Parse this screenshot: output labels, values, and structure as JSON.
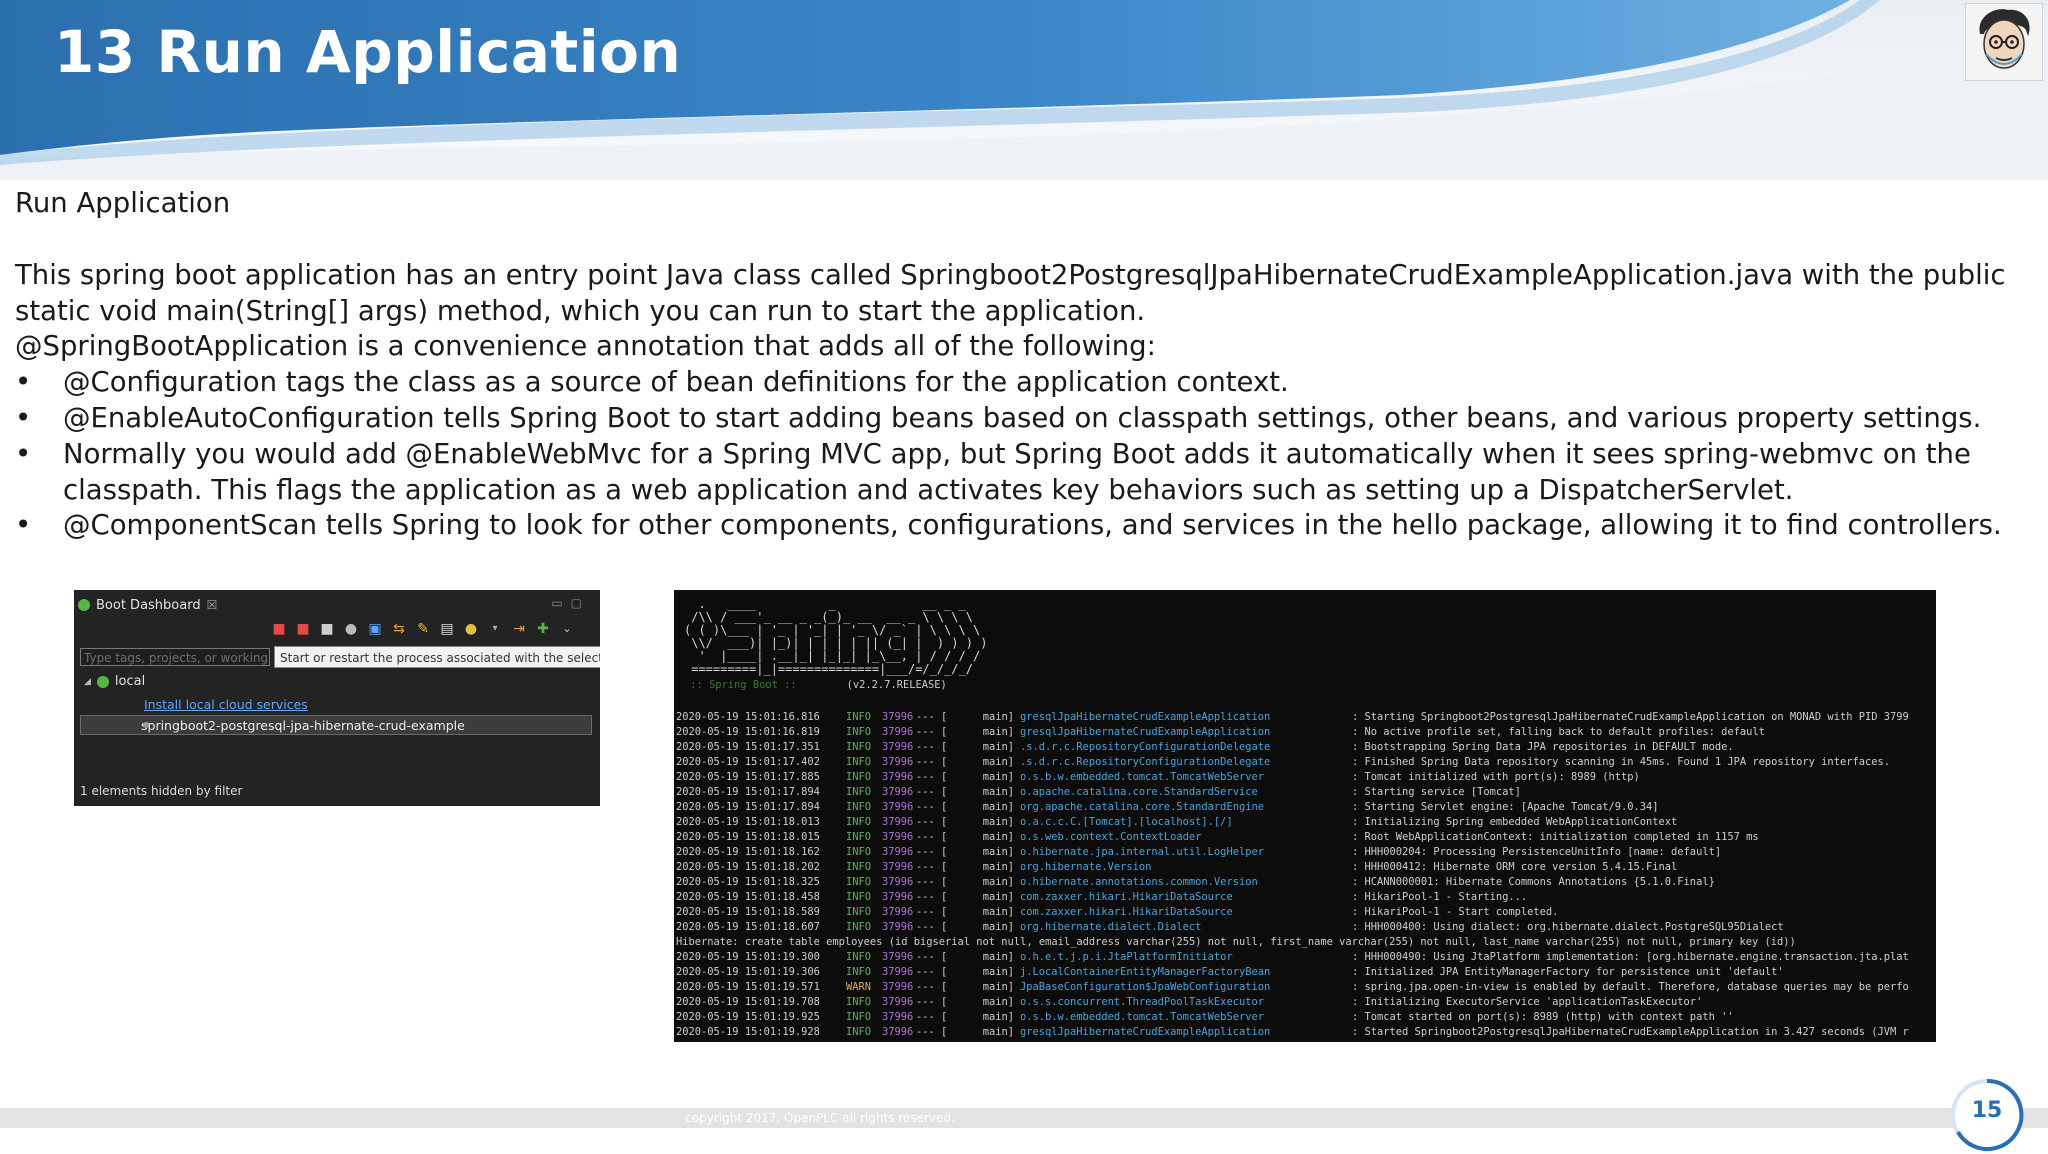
{
  "header": {
    "title": "13 Run Application"
  },
  "colors": {
    "header_blue": "#2a73b9",
    "page_number_ring": "#2a6fb3"
  },
  "content": {
    "heading": "Run Application",
    "para1_line1": "This spring boot application has an entry point Java class called Springboot2PostgresqlJpaHibernateCrudExampleApplication.java with the public",
    "para1_line2": "static void main(String[] args) method, which you can run to start the application.",
    "para2": "@SpringBootApplication is a convenience annotation that adds all of the following:",
    "bullet_char": "•",
    "bullets": [
      "@Configuration tags the class as a source of bean definitions for the application context.",
      "@EnableAutoConfiguration tells Spring Boot to start adding beans based on classpath settings, other beans, and various property settings.",
      "Normally you would add @EnableWebMvc for a Spring MVC app, but Spring Boot adds it automatically when it sees spring-webmvc on the",
      "@ComponentScan tells Spring to look for other components, configurations, and services in the hello package, allowing it to find controllers."
    ],
    "bullet3_cont": "classpath. This flags the application as a web application and activates key behaviors such as setting up a DispatcherServlet."
  },
  "boot_dashboard": {
    "tab_label": "Boot Dashboard",
    "tab_close": "☒",
    "filter_placeholder": "Type tags, projects, or working",
    "tooltip": "Start or restart the process associated with the select",
    "local_label": "local",
    "link": "Install local cloud services",
    "app_name": "springboot2-postgresql-jpa-hibernate-crud-example",
    "hidden_text": "1 elements hidden by filter"
  },
  "console": {
    "banner_lines": [
      "  .   ____          _            __ _ _",
      " /\\\\ / ___'_ __ _ _(_)_ __  __ _ \\ \\ \\ \\",
      "( ( )\\___ | '_ | '_| | '_ \\/ _` | \\ \\ \\ \\",
      " \\\\/  ___)| |_)| | | | | || (_| |  ) ) ) )",
      "  '  |____| .__|_| |_|_| |_\\__, | / / / /",
      " =========|_|==============|___/=/_/_/_/"
    ],
    "spring_boot_label": " :: Spring Boot :: ",
    "version": "       (v2.2.7.RELEASE)",
    "separator": "---",
    "bracket": "[",
    "rows": [
      {
        "ts": "2020-05-19 15:01:16.816",
        "level": "INFO",
        "pid": "37996",
        "thread": "main]",
        "logger": "gresqlJpaHibernateCrudExampleApplication",
        "msg": ": Starting Springboot2PostgresqlJpaHibernateCrudExampleApplication on MONAD with PID 3799"
      },
      {
        "ts": "2020-05-19 15:01:16.819",
        "level": "INFO",
        "pid": "37996",
        "thread": "main]",
        "logger": "gresqlJpaHibernateCrudExampleApplication",
        "msg": ": No active profile set, falling back to default profiles: default"
      },
      {
        "ts": "2020-05-19 15:01:17.351",
        "level": "INFO",
        "pid": "37996",
        "thread": "main]",
        "logger": ".s.d.r.c.RepositoryConfigurationDelegate",
        "msg": ": Bootstrapping Spring Data JPA repositories in DEFAULT mode."
      },
      {
        "ts": "2020-05-19 15:01:17.402",
        "level": "INFO",
        "pid": "37996",
        "thread": "main]",
        "logger": ".s.d.r.c.RepositoryConfigurationDelegate",
        "msg": ": Finished Spring Data repository scanning in 45ms. Found 1 JPA repository interfaces."
      },
      {
        "ts": "2020-05-19 15:01:17.885",
        "level": "INFO",
        "pid": "37996",
        "thread": "main]",
        "logger": "o.s.b.w.embedded.tomcat.TomcatWebServer",
        "msg": ": Tomcat initialized with port(s): 8989 (http)"
      },
      {
        "ts": "2020-05-19 15:01:17.894",
        "level": "INFO",
        "pid": "37996",
        "thread": "main]",
        "logger": "o.apache.catalina.core.StandardService",
        "msg": ": Starting service [Tomcat]"
      },
      {
        "ts": "2020-05-19 15:01:17.894",
        "level": "INFO",
        "pid": "37996",
        "thread": "main]",
        "logger": "org.apache.catalina.core.StandardEngine",
        "msg": ": Starting Servlet engine: [Apache Tomcat/9.0.34]"
      },
      {
        "ts": "2020-05-19 15:01:18.013",
        "level": "INFO",
        "pid": "37996",
        "thread": "main]",
        "logger": "o.a.c.c.C.[Tomcat].[localhost].[/]",
        "msg": ": Initializing Spring embedded WebApplicationContext"
      },
      {
        "ts": "2020-05-19 15:01:18.015",
        "level": "INFO",
        "pid": "37996",
        "thread": "main]",
        "logger": "o.s.web.context.ContextLoader",
        "msg": ": Root WebApplicationContext: initialization completed in 1157 ms"
      },
      {
        "ts": "2020-05-19 15:01:18.162",
        "level": "INFO",
        "pid": "37996",
        "thread": "main]",
        "logger": "o.hibernate.jpa.internal.util.LogHelper",
        "msg": ": HHH000204: Processing PersistenceUnitInfo [name: default]"
      },
      {
        "ts": "2020-05-19 15:01:18.202",
        "level": "INFO",
        "pid": "37996",
        "thread": "main]",
        "logger": "org.hibernate.Version",
        "msg": ": HHH000412: Hibernate ORM core version 5.4.15.Final"
      },
      {
        "ts": "2020-05-19 15:01:18.325",
        "level": "INFO",
        "pid": "37996",
        "thread": "main]",
        "logger": "o.hibernate.annotations.common.Version",
        "msg": ": HCANN000001: Hibernate Commons Annotations {5.1.0.Final}"
      },
      {
        "ts": "2020-05-19 15:01:18.458",
        "level": "INFO",
        "pid": "37996",
        "thread": "main]",
        "logger": "com.zaxxer.hikari.HikariDataSource",
        "msg": ": HikariPool-1 - Starting..."
      },
      {
        "ts": "2020-05-19 15:01:18.589",
        "level": "INFO",
        "pid": "37996",
        "thread": "main]",
        "logger": "com.zaxxer.hikari.HikariDataSource",
        "msg": ": HikariPool-1 - Start completed."
      },
      {
        "ts": "2020-05-19 15:01:18.607",
        "level": "INFO",
        "pid": "37996",
        "thread": "main]",
        "logger": "org.hibernate.dialect.Dialect",
        "msg": ": HHH000400: Using dialect: org.hibernate.dialect.PostgreSQL95Dialect"
      },
      {
        "full": "Hibernate: create table employees (id  bigserial not null, email_address varchar(255) not null, first_name varchar(255) not null, last_name varchar(255) not null, primary key (id))"
      },
      {
        "ts": "2020-05-19 15:01:19.300",
        "level": "INFO",
        "pid": "37996",
        "thread": "main]",
        "logger": "o.h.e.t.j.p.i.JtaPlatformInitiator",
        "msg": ": HHH000490: Using JtaPlatform implementation: [org.hibernate.engine.transaction.jta.plat"
      },
      {
        "ts": "2020-05-19 15:01:19.306",
        "level": "INFO",
        "pid": "37996",
        "thread": "main]",
        "logger": "j.LocalContainerEntityManagerFactoryBean",
        "msg": ": Initialized JPA EntityManagerFactory for persistence unit 'default'"
      },
      {
        "ts": "2020-05-19 15:01:19.571",
        "level": "WARN",
        "pid": "37996",
        "thread": "main]",
        "logger": "JpaBaseConfiguration$JpaWebConfiguration",
        "msg": ": spring.jpa.open-in-view is enabled by default. Therefore, database queries may be perfo"
      },
      {
        "ts": "2020-05-19 15:01:19.708",
        "level": "INFO",
        "pid": "37996",
        "thread": "main]",
        "logger": "o.s.s.concurrent.ThreadPoolTaskExecutor",
        "msg": ": Initializing ExecutorService 'applicationTaskExecutor'"
      },
      {
        "ts": "2020-05-19 15:01:19.925",
        "level": "INFO",
        "pid": "37996",
        "thread": "main]",
        "logger": "o.s.b.w.embedded.tomcat.TomcatWebServer",
        "msg": ": Tomcat started on port(s): 8989 (http) with context path ''"
      },
      {
        "ts": "2020-05-19 15:01:19.928",
        "level": "INFO",
        "pid": "37996",
        "thread": "main]",
        "logger": "gresqlJpaHibernateCrudExampleApplication",
        "msg": ": Started Springboot2PostgresqlJpaHibernateCrudExampleApplication in 3.427 seconds (JVM r"
      }
    ]
  },
  "footer": {
    "copyright": "copyright 2017. OpenPLC all rights reserved.",
    "page_number": "15"
  }
}
